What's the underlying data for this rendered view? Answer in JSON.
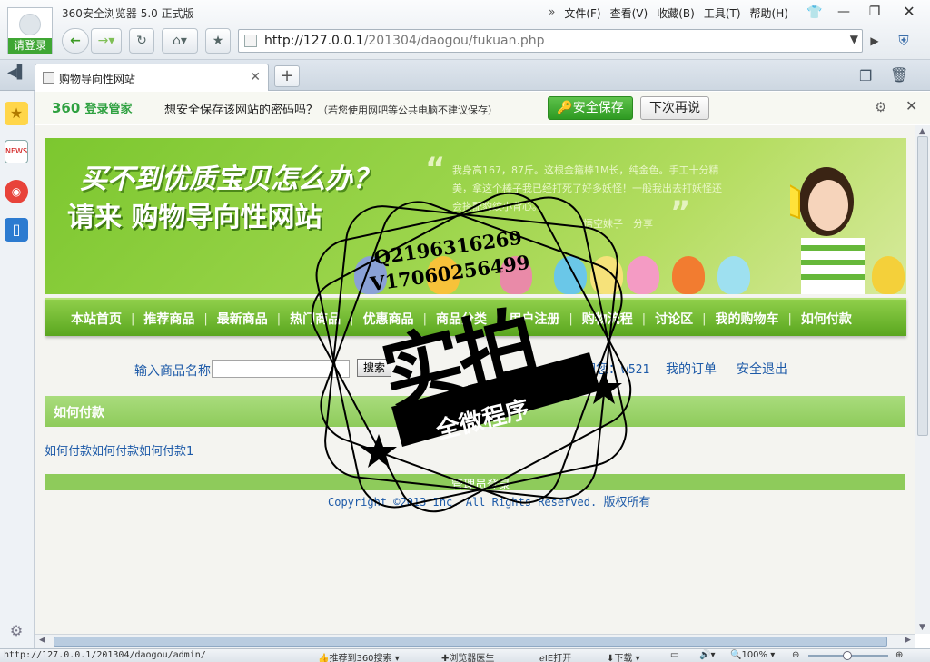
{
  "browser": {
    "title": "360安全浏览器 5.0 正式版",
    "login_label": "请登录",
    "menu": [
      "文件(F)",
      "查看(V)",
      "收藏(B)",
      "工具(T)",
      "帮助(H)"
    ],
    "menu_chevron": "»",
    "url_host": "http://127.0.0.1",
    "url_path": "/201304/daogou/fukuan.php",
    "tab_title": "购物导向性网站",
    "status_url": "http://127.0.0.1/201304/daogou/admin/",
    "status_items": {
      "recommend": "推荐到360搜索",
      "doctor": "浏览器医生",
      "ie_open": "IE打开",
      "download": "下载",
      "zoom": "100%"
    }
  },
  "password_bar": {
    "logo": "360",
    "logo_text": "登录管家",
    "message": "想安全保存该网站的密码吗？",
    "note": "（若您使用网吧等公共电脑不建议保存）",
    "save_label": "安全保存",
    "later_label": "下次再说"
  },
  "banner": {
    "headline": "买不到优质宝贝怎么办？",
    "subhead": "请来 购物导向性网站",
    "quote": "我身高167，87斤。这根金箍棒1M长，纯金色。手工十分精美，拿这个棒子我已经打死了好多妖怪！一般我出去打妖怪还会搭配豹纹小背心。",
    "author": "悟空妹子",
    "share": "分享"
  },
  "nav": [
    "本站首页",
    "推荐商品",
    "最新商品",
    "热门商品",
    "优惠商品",
    "商品分类",
    "用户注册",
    "购物流程",
    "讨论区",
    "我的购物车",
    "如何付款"
  ],
  "nav_sep": "|",
  "search": {
    "label": "输入商品名称",
    "value": "",
    "button": "搜索"
  },
  "user": {
    "welcome": "欢迎您：",
    "username": "w521",
    "orders": "我的订单",
    "logout": "安全退出"
  },
  "section": {
    "title": "如何付款",
    "body": "如何付款如何付款如何付款1"
  },
  "footer": {
    "admin": "管理员登录",
    "copyright": "Copyright ©2013 Inc. All Rights Reserved.",
    "copyright_cn": "版权所有"
  },
  "watermark": {
    "qq": "Q2196316269",
    "wechat": "V17060256499",
    "big": "实拍",
    "ribbon": "全微程序"
  }
}
